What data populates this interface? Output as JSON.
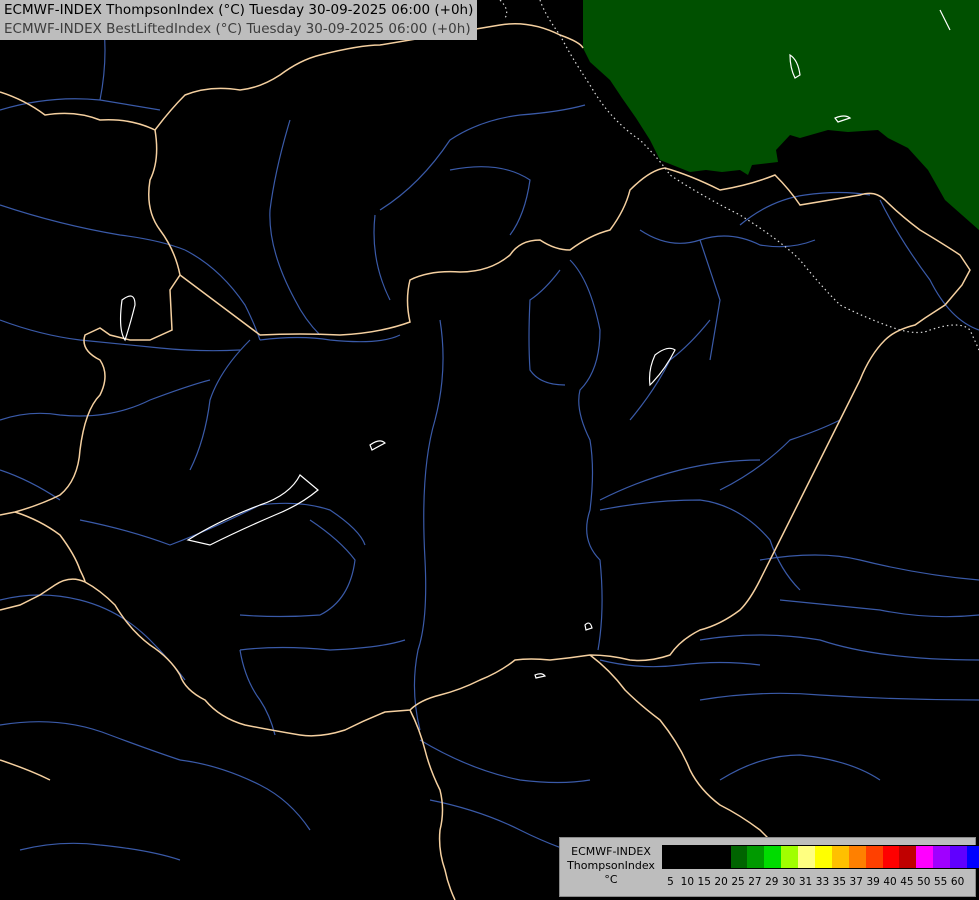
{
  "header": {
    "line1": "ECMWF-INDEX ThompsonIndex (°C) Tuesday 30-09-2025 06:00 (+0h)",
    "line2": "ECMWF-INDEX BestLiftedIndex (°C) Tuesday 30-09-2025 06:00 (+0h)"
  },
  "legend": {
    "source": "ECMWF-INDEX",
    "parameter": "ThompsonIndex",
    "unit": "°C",
    "ticks": [
      "5",
      "10",
      "15",
      "20",
      "25",
      "27",
      "29",
      "30",
      "31",
      "33",
      "35",
      "37",
      "39",
      "40",
      "45",
      "50",
      "55",
      "60"
    ],
    "colors": [
      "#000000",
      "#000000",
      "#000000",
      "#000000",
      "#006400",
      "#009a00",
      "#00dc00",
      "#a0ff00",
      "#ffff80",
      "#ffff00",
      "#ffc000",
      "#ff8000",
      "#ff4000",
      "#ff0000",
      "#c00000",
      "#ff00ff",
      "#a000ff",
      "#6000ff",
      "#0000ff"
    ]
  },
  "map": {
    "background_color": "#000000",
    "border_color": "#f5d0a0",
    "river_color": "#3a5aa8",
    "lake_color": "#ffffff",
    "field_color": "#005000"
  }
}
